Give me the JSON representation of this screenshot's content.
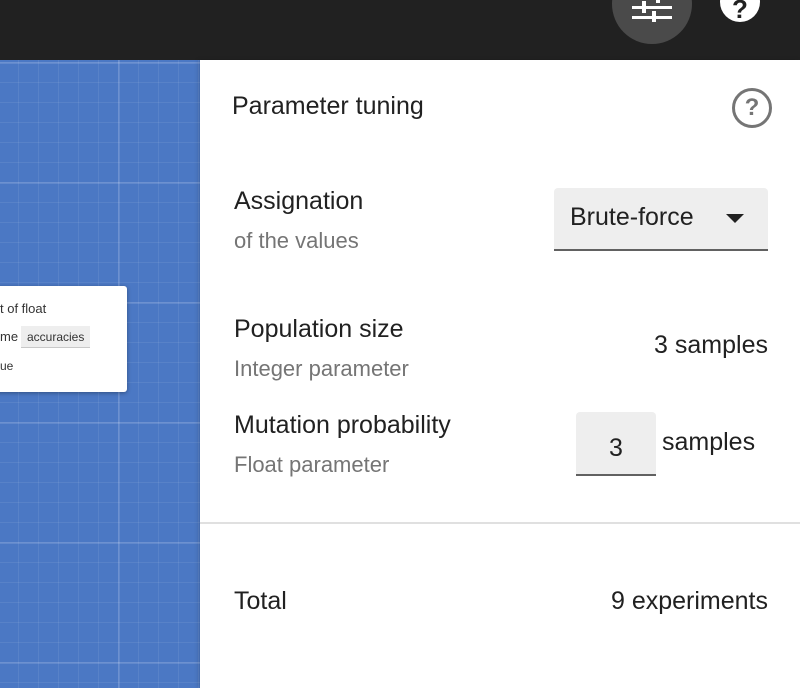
{
  "toolbar": {
    "tune_icon": "tune-icon",
    "help_icon": "help-icon",
    "help_glyph": "?"
  },
  "canvas": {
    "node": {
      "line1": "t of float",
      "line2_prefix": "me",
      "chip": "accuracies",
      "line3": "ue"
    }
  },
  "panel": {
    "title": "Parameter tuning",
    "help_icon": "help-outline-icon",
    "help_glyph": "?",
    "assignation": {
      "label": "Assignation",
      "sublabel": "of the values",
      "selected": "Brute-force"
    },
    "population": {
      "label": "Population size",
      "sublabel": "Integer parameter",
      "value": "3 samples"
    },
    "mutation": {
      "label": "Mutation probability",
      "sublabel": "Float parameter",
      "input_value": "3",
      "unit": "samples"
    },
    "total": {
      "label": "Total",
      "value": "9 experiments"
    }
  },
  "colors": {
    "topbar": "#212121",
    "canvas": "#4b78c4",
    "panel": "#ffffff"
  }
}
